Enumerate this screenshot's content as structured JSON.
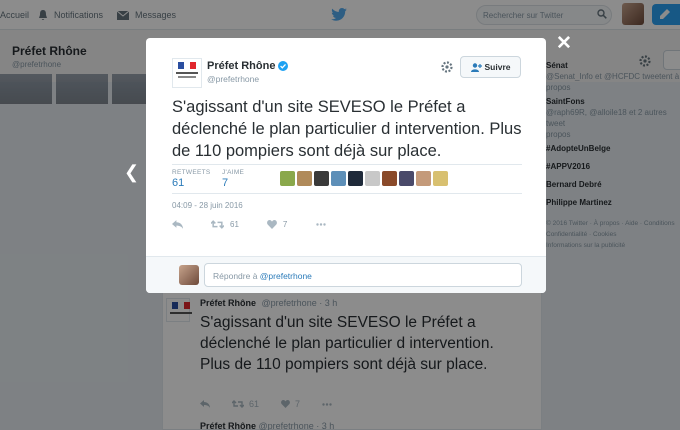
{
  "topnav": {
    "home_label": "Accueil",
    "notifications_label": "Notifications",
    "messages_label": "Messages",
    "search_placeholder": "Rechercher sur Twitter"
  },
  "background_profile": {
    "name": "Préfet Rhône",
    "handle": "@prefetrhone",
    "sidebar": {
      "line1": "Sénat",
      "line2": "@Senat_Info et @HCFDC tweetent à",
      "line3": "propos",
      "item1": "SaintFons",
      "item1_sub": "@raph69R, @alloile18 et 2 autres tweet",
      "item1_sub2": "propos",
      "item2": "#AdopteUnBelge",
      "item3": "#APPV2016",
      "item4": "Bernard Debré",
      "item5": "Philippe Martinez",
      "footer1": "© 2016 Twitter · À propos · Aide · Conditions",
      "footer2": "Confidentialité · Cookies",
      "footer3": "Informations sur la publicité"
    }
  },
  "background_tweet": {
    "name": "Préfet Rhône",
    "handle": "@prefetrhone · 3 h",
    "text": "S'agissant d'un site SEVESO le Préfet a déclenché le plan particulier d intervention. Plus de 110 pompiers sont déjà sur place.",
    "retweets": "61",
    "likes": "7",
    "next_name": "Préfet Rhône",
    "next_handle": "@prefetrhone · 3 h"
  },
  "modal": {
    "name": "Préfet Rhône",
    "handle": "@prefetrhone",
    "follow_label": "Suivre",
    "text": "S'agissant d'un site SEVESO le Préfet a déclenché le plan particulier d intervention. Plus de 110 pompiers sont déjà sur place.",
    "retweets_label": "RETWEETS",
    "retweets_value": "61",
    "likes_label": "J'AIME",
    "likes_value": "7",
    "timestamp": "04:09 - 28 juin 2016",
    "action_retweet_count": "61",
    "action_like_count": "7",
    "reply_prompt": "Répondre à ",
    "reply_handle": "@prefetrhone",
    "likers_colors": [
      "#8aa84b",
      "#b08a5a",
      "#3a3a3a",
      "#5d8fb8",
      "#1f2a3a",
      "#c8c8c8",
      "#8a4a2a",
      "#4a4a6a",
      "#c49a7a",
      "#d8c070"
    ]
  },
  "colors": {
    "accent": "#2aa1f2",
    "link": "#2b7bb9",
    "text": "#292f33",
    "muted": "#8899a6",
    "overlay": "rgba(0,0,0,0.45)"
  },
  "icons": {
    "home": "home-icon",
    "notifications": "bell-icon",
    "messages": "envelope-icon",
    "twitter": "bird-icon",
    "search": "search-icon",
    "verified": "verified-badge-icon",
    "settings": "gear-icon",
    "follow": "person-plus-icon",
    "reply": "reply-icon",
    "retweet": "retweet-icon",
    "like": "heart-icon",
    "more": "more-icon",
    "close": "close-icon",
    "previous": "chevron-left-icon"
  }
}
